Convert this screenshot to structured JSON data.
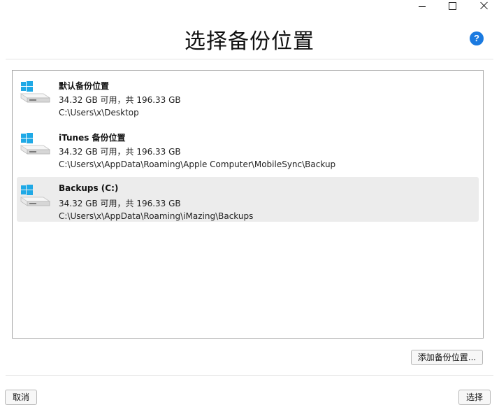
{
  "window": {
    "controls": [
      {
        "name": "minimize-icon",
        "glyph": "minimize"
      },
      {
        "name": "maximize-icon",
        "glyph": "maximize"
      },
      {
        "name": "close-icon",
        "glyph": "close"
      }
    ]
  },
  "header": {
    "title": "选择备份位置",
    "help_label": "?",
    "help_color": "#1a7ae0"
  },
  "locations": [
    {
      "name": "默认备份位置",
      "space": "34.32 GB 可用，共 196.33 GB",
      "path": "C:\\Users\\x\\Desktop",
      "icon": "drive-icon",
      "selected": false
    },
    {
      "name": "iTunes 备份位置",
      "space": "34.32 GB 可用，共 196.33 GB",
      "path": "C:\\Users\\x\\AppData\\Roaming\\Apple Computer\\MobileSync\\Backup",
      "icon": "drive-icon",
      "selected": false
    },
    {
      "name": "Backups (C:)",
      "space": "34.32 GB 可用，共 196.33 GB",
      "path": "C:\\Users\\x\\AppData\\Roaming\\iMazing\\Backups",
      "icon": "drive-icon",
      "selected": true
    }
  ],
  "buttons": {
    "add": "添加备份位置...",
    "cancel": "取消",
    "choose": "选择"
  },
  "colors": {
    "windows_logo": "#1fa9e6",
    "selected_bg": "#ececec"
  }
}
